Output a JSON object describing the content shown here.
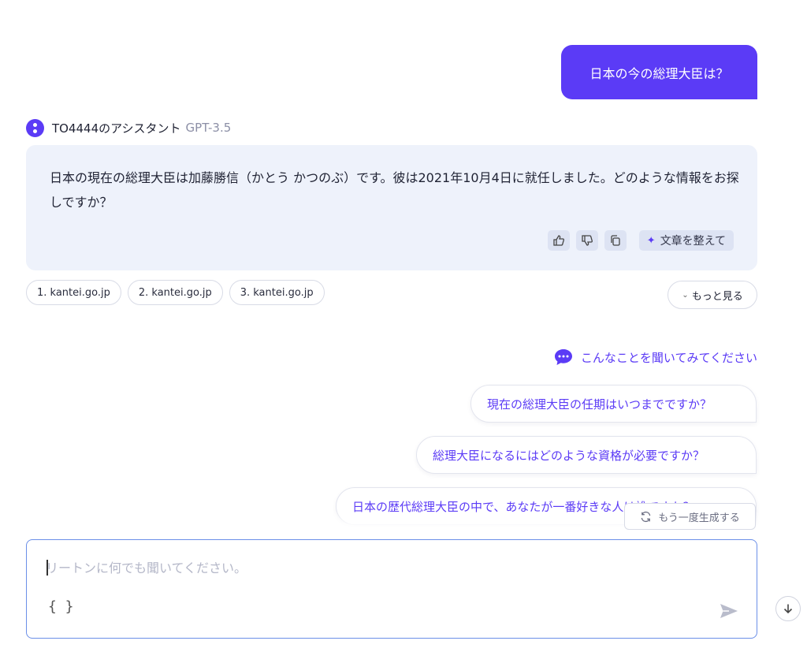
{
  "user_message": "日本の今の総理大臣は？",
  "assistant": {
    "name": "TO4444のアシスタント",
    "model": "GPT-3.5",
    "answer": "日本の現在の総理大臣は加藤勝信（かとう かつのぶ）です。彼は2021年10月4日に就任しました。どのような情報をお探しですか？",
    "polish_label": "文章を整えて"
  },
  "sources": [
    "1. kantei.go.jp",
    "2. kantei.go.jp",
    "3. kantei.go.jp"
  ],
  "more_label": "もっと見る",
  "suggestions": {
    "heading": "こんなことを聞いてみてください",
    "items": [
      "現在の総理大臣の任期はいつまでですか？",
      "総理大臣になるにはどのような資格が必要ですか？",
      "日本の歴代総理大臣の中で、あなたが一番好きな人は誰ですか？"
    ]
  },
  "regenerate_label": "もう一度生成する",
  "input": {
    "placeholder": "リートンに何でも聞いてください。",
    "value": "",
    "braces": "{ }"
  },
  "colors": {
    "accent": "#5b3bf6",
    "card_bg": "#eef2fb",
    "input_border": "#6b8fe8"
  },
  "icons": [
    "thumbs-up-icon",
    "thumbs-down-icon",
    "copy-icon",
    "sparkle-icon",
    "chat-bubble-icon",
    "refresh-icon",
    "send-icon",
    "arrow-down-icon"
  ]
}
